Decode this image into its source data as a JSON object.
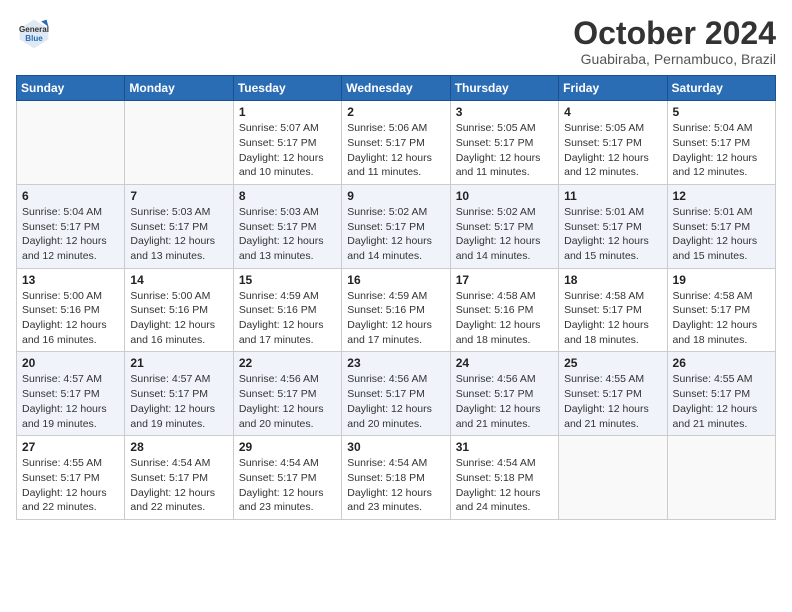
{
  "logo": {
    "general": "General",
    "blue": "Blue"
  },
  "title": {
    "month": "October 2024",
    "location": "Guabiraba, Pernambuco, Brazil"
  },
  "days_of_week": [
    "Sunday",
    "Monday",
    "Tuesday",
    "Wednesday",
    "Thursday",
    "Friday",
    "Saturday"
  ],
  "weeks": [
    [
      {
        "day": "",
        "info": ""
      },
      {
        "day": "",
        "info": ""
      },
      {
        "day": "1",
        "info": "Sunrise: 5:07 AM\nSunset: 5:17 PM\nDaylight: 12 hours\nand 10 minutes."
      },
      {
        "day": "2",
        "info": "Sunrise: 5:06 AM\nSunset: 5:17 PM\nDaylight: 12 hours\nand 11 minutes."
      },
      {
        "day": "3",
        "info": "Sunrise: 5:05 AM\nSunset: 5:17 PM\nDaylight: 12 hours\nand 11 minutes."
      },
      {
        "day": "4",
        "info": "Sunrise: 5:05 AM\nSunset: 5:17 PM\nDaylight: 12 hours\nand 12 minutes."
      },
      {
        "day": "5",
        "info": "Sunrise: 5:04 AM\nSunset: 5:17 PM\nDaylight: 12 hours\nand 12 minutes."
      }
    ],
    [
      {
        "day": "6",
        "info": "Sunrise: 5:04 AM\nSunset: 5:17 PM\nDaylight: 12 hours\nand 12 minutes."
      },
      {
        "day": "7",
        "info": "Sunrise: 5:03 AM\nSunset: 5:17 PM\nDaylight: 12 hours\nand 13 minutes."
      },
      {
        "day": "8",
        "info": "Sunrise: 5:03 AM\nSunset: 5:17 PM\nDaylight: 12 hours\nand 13 minutes."
      },
      {
        "day": "9",
        "info": "Sunrise: 5:02 AM\nSunset: 5:17 PM\nDaylight: 12 hours\nand 14 minutes."
      },
      {
        "day": "10",
        "info": "Sunrise: 5:02 AM\nSunset: 5:17 PM\nDaylight: 12 hours\nand 14 minutes."
      },
      {
        "day": "11",
        "info": "Sunrise: 5:01 AM\nSunset: 5:17 PM\nDaylight: 12 hours\nand 15 minutes."
      },
      {
        "day": "12",
        "info": "Sunrise: 5:01 AM\nSunset: 5:17 PM\nDaylight: 12 hours\nand 15 minutes."
      }
    ],
    [
      {
        "day": "13",
        "info": "Sunrise: 5:00 AM\nSunset: 5:16 PM\nDaylight: 12 hours\nand 16 minutes."
      },
      {
        "day": "14",
        "info": "Sunrise: 5:00 AM\nSunset: 5:16 PM\nDaylight: 12 hours\nand 16 minutes."
      },
      {
        "day": "15",
        "info": "Sunrise: 4:59 AM\nSunset: 5:16 PM\nDaylight: 12 hours\nand 17 minutes."
      },
      {
        "day": "16",
        "info": "Sunrise: 4:59 AM\nSunset: 5:16 PM\nDaylight: 12 hours\nand 17 minutes."
      },
      {
        "day": "17",
        "info": "Sunrise: 4:58 AM\nSunset: 5:16 PM\nDaylight: 12 hours\nand 18 minutes."
      },
      {
        "day": "18",
        "info": "Sunrise: 4:58 AM\nSunset: 5:17 PM\nDaylight: 12 hours\nand 18 minutes."
      },
      {
        "day": "19",
        "info": "Sunrise: 4:58 AM\nSunset: 5:17 PM\nDaylight: 12 hours\nand 18 minutes."
      }
    ],
    [
      {
        "day": "20",
        "info": "Sunrise: 4:57 AM\nSunset: 5:17 PM\nDaylight: 12 hours\nand 19 minutes."
      },
      {
        "day": "21",
        "info": "Sunrise: 4:57 AM\nSunset: 5:17 PM\nDaylight: 12 hours\nand 19 minutes."
      },
      {
        "day": "22",
        "info": "Sunrise: 4:56 AM\nSunset: 5:17 PM\nDaylight: 12 hours\nand 20 minutes."
      },
      {
        "day": "23",
        "info": "Sunrise: 4:56 AM\nSunset: 5:17 PM\nDaylight: 12 hours\nand 20 minutes."
      },
      {
        "day": "24",
        "info": "Sunrise: 4:56 AM\nSunset: 5:17 PM\nDaylight: 12 hours\nand 21 minutes."
      },
      {
        "day": "25",
        "info": "Sunrise: 4:55 AM\nSunset: 5:17 PM\nDaylight: 12 hours\nand 21 minutes."
      },
      {
        "day": "26",
        "info": "Sunrise: 4:55 AM\nSunset: 5:17 PM\nDaylight: 12 hours\nand 21 minutes."
      }
    ],
    [
      {
        "day": "27",
        "info": "Sunrise: 4:55 AM\nSunset: 5:17 PM\nDaylight: 12 hours\nand 22 minutes."
      },
      {
        "day": "28",
        "info": "Sunrise: 4:54 AM\nSunset: 5:17 PM\nDaylight: 12 hours\nand 22 minutes."
      },
      {
        "day": "29",
        "info": "Sunrise: 4:54 AM\nSunset: 5:17 PM\nDaylight: 12 hours\nand 23 minutes."
      },
      {
        "day": "30",
        "info": "Sunrise: 4:54 AM\nSunset: 5:18 PM\nDaylight: 12 hours\nand 23 minutes."
      },
      {
        "day": "31",
        "info": "Sunrise: 4:54 AM\nSunset: 5:18 PM\nDaylight: 12 hours\nand 24 minutes."
      },
      {
        "day": "",
        "info": ""
      },
      {
        "day": "",
        "info": ""
      }
    ]
  ]
}
